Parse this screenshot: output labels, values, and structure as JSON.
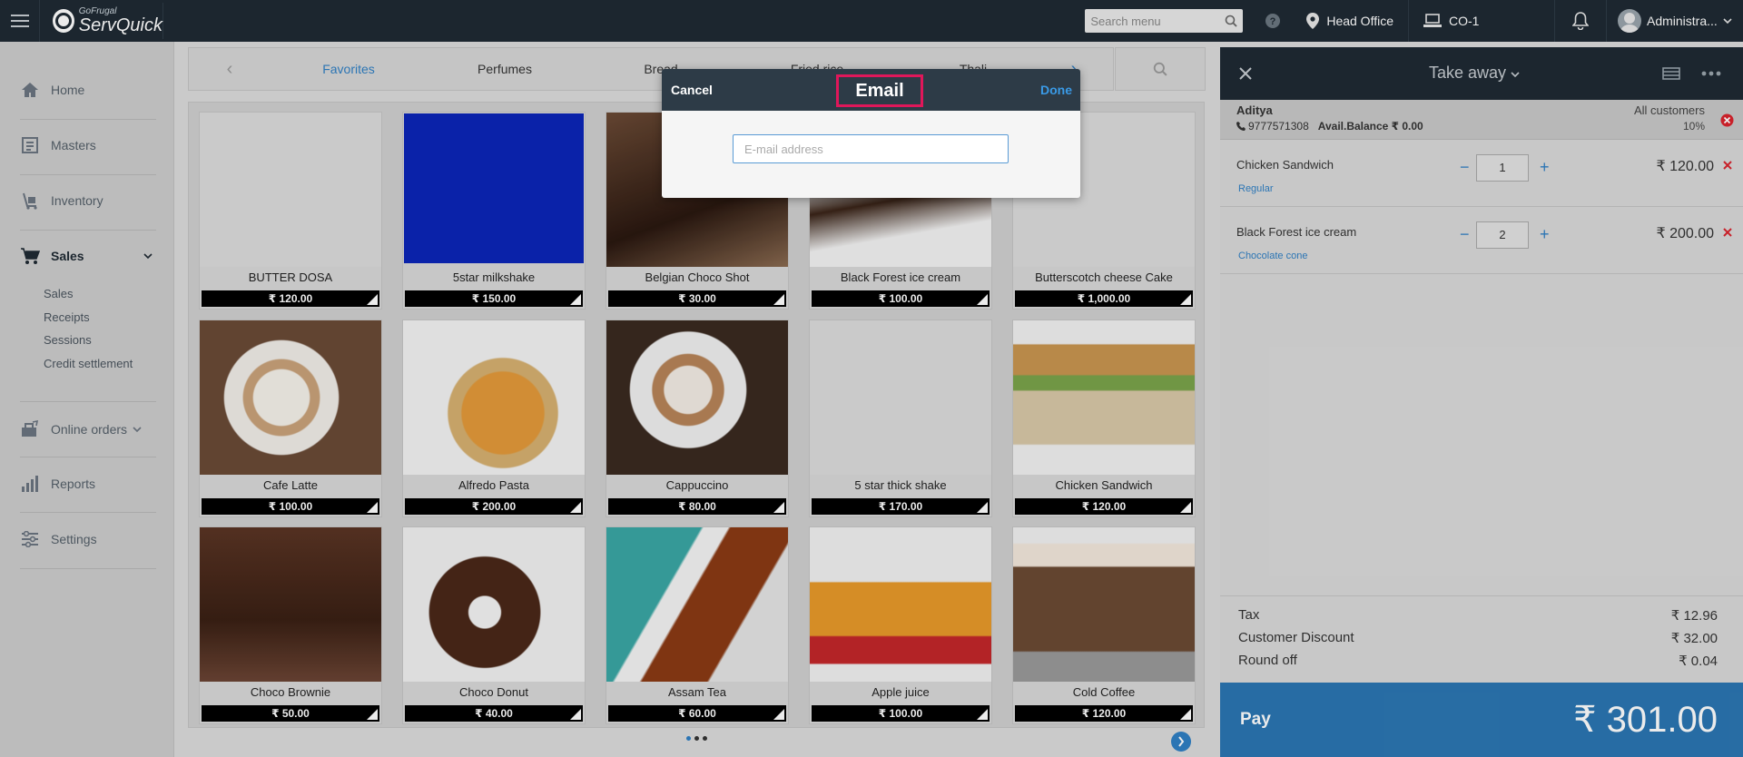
{
  "app": {
    "brand_small": "GoFrugal",
    "brand_name": "ServQuick"
  },
  "topbar": {
    "search_placeholder": "Search menu",
    "location": "Head Office",
    "counter": "CO-1",
    "user": "Administra..."
  },
  "sidebar": {
    "items": [
      {
        "label": "Home",
        "icon": "home-icon"
      },
      {
        "label": "Masters",
        "icon": "masters-icon"
      },
      {
        "label": "Inventory",
        "icon": "inventory-icon"
      },
      {
        "label": "Sales",
        "icon": "cart-icon"
      },
      {
        "label": "Online orders",
        "icon": "online-orders-icon"
      },
      {
        "label": "Reports",
        "icon": "reports-icon"
      },
      {
        "label": "Settings",
        "icon": "settings-icon"
      }
    ],
    "sales_sub": [
      "Sales",
      "Receipts",
      "Sessions",
      "Credit settlement"
    ]
  },
  "categories": [
    "Favorites",
    "Perfumes",
    "Bread",
    "Fried rice",
    "Thali"
  ],
  "products": [
    {
      "name": "BUTTER DOSA",
      "price": "₹ 120.00"
    },
    {
      "name": "5star milkshake",
      "price": "₹ 150.00"
    },
    {
      "name": "Belgian Choco Shot",
      "price": "₹ 30.00"
    },
    {
      "name": "Black Forest ice cream",
      "price": "₹ 100.00"
    },
    {
      "name": "Butterscotch cheese Cake",
      "price": "₹ 1,000.00"
    },
    {
      "name": "Cafe Latte",
      "price": "₹ 100.00"
    },
    {
      "name": "Alfredo Pasta",
      "price": "₹ 200.00"
    },
    {
      "name": "Cappuccino",
      "price": "₹ 80.00"
    },
    {
      "name": "5 star thick shake",
      "price": "₹ 170.00"
    },
    {
      "name": "Chicken Sandwich",
      "price": "₹ 120.00"
    },
    {
      "name": "Choco Brownie",
      "price": "₹ 50.00"
    },
    {
      "name": "Choco Donut",
      "price": "₹ 40.00"
    },
    {
      "name": "Assam Tea",
      "price": "₹ 60.00"
    },
    {
      "name": "Apple juice",
      "price": "₹ 100.00"
    },
    {
      "name": "Cold Coffee",
      "price": "₹ 120.00"
    }
  ],
  "cart": {
    "order_type": "Take away",
    "customer": {
      "name": "Aditya",
      "phone": "9777571308",
      "balance_label": "Avail.Balance ₹ 0.00",
      "group": "All customers",
      "discount": "10%"
    },
    "lines": [
      {
        "name": "Chicken Sandwich",
        "variant": "Regular",
        "qty": "1",
        "amount": "₹ 120.00"
      },
      {
        "name": "Black Forest ice cream",
        "variant": "Chocolate cone",
        "qty": "2",
        "amount": "₹ 200.00"
      }
    ],
    "totals": [
      {
        "label": "Tax",
        "value": "₹ 12.96"
      },
      {
        "label": "Customer Discount",
        "value": "₹ 32.00"
      },
      {
        "label": "Round off",
        "value": "₹ 0.04"
      }
    ],
    "pay_label": "Pay",
    "pay_amount": "₹ 301.00"
  },
  "modal": {
    "cancel": "Cancel",
    "title": "Email",
    "done": "Done",
    "email_placeholder": "E-mail address",
    "email_value": ""
  },
  "colors": {
    "accent": "#2f7fc4",
    "highlight": "#e0175a",
    "pay": "#2b76b2"
  }
}
